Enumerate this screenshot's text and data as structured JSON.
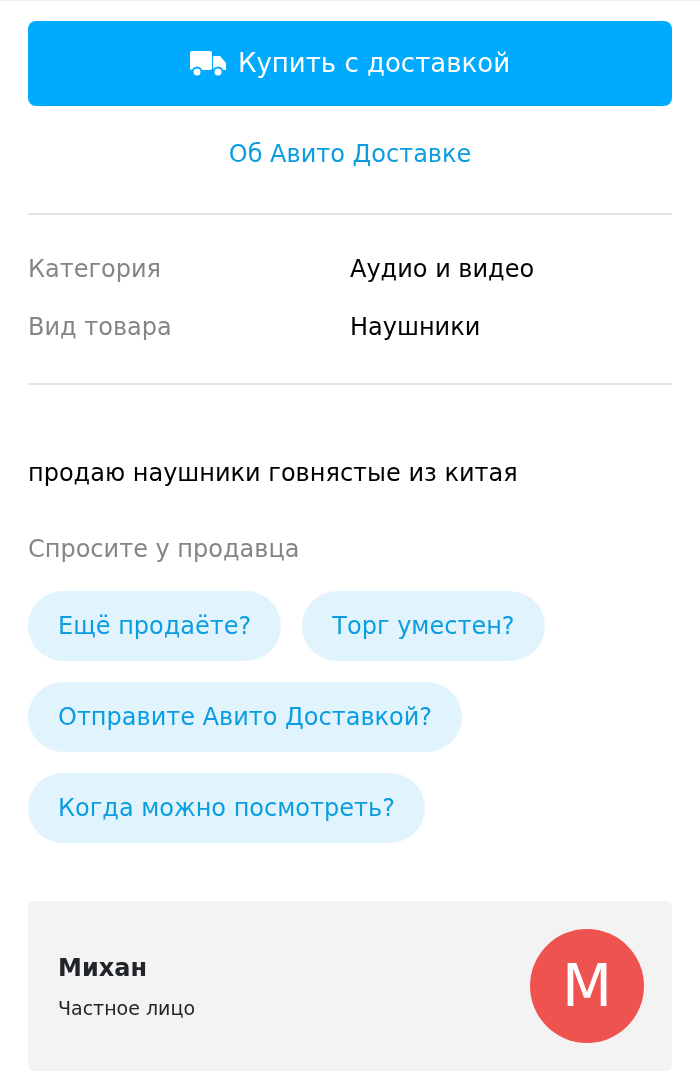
{
  "buy_button": {
    "label": "Купить с доставкой"
  },
  "delivery_link": "Об Авито Доставке",
  "params": [
    {
      "label": "Категория",
      "value": "Аудио и видео"
    },
    {
      "label": "Вид товара",
      "value": "Наушники"
    }
  ],
  "description": "продаю наушники говнястые из китая",
  "ask_seller": {
    "title": "Спросите у продавца",
    "questions": [
      [
        "Ещё продаёте?",
        "Торг уместен?"
      ],
      [
        "Отправите Авито Доставкой?"
      ],
      [
        "Когда можно посмотреть?"
      ]
    ]
  },
  "seller": {
    "name": "Михан",
    "type": "Частное лицо",
    "avatar_letter": "М"
  }
}
